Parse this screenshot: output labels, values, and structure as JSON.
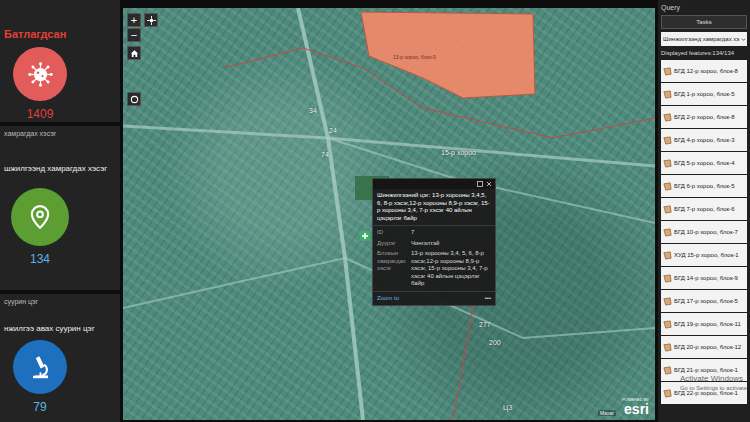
{
  "stats": [
    {
      "title": "Батлагдсан",
      "value": "1409",
      "title_color": "#e0403a",
      "color": "#e25c5c",
      "value_color": "#e0403a",
      "kind": "virus"
    },
    {
      "title": "хамрагдах хэсэг",
      "description": "шжилгээнд хамрагдах хэсэг",
      "value": "134",
      "title_color": "#bbbbbb",
      "color": "#5c9e32",
      "value_color": "#5bb4e6",
      "kind": "pin"
    },
    {
      "title": "суурин цэг",
      "description": "нжилгээ авах суурин цэг",
      "value": "79",
      "title_color": "#bbbbbb",
      "color": "#1f6fbf",
      "value_color": "#5bb4e6",
      "kind": "microscope"
    }
  ],
  "map": {
    "zoom_in": "+",
    "zoom_out": "−",
    "area_label": "13-р хороо, блок-9",
    "labels": [
      "15-р хороо",
      "74",
      "34",
      "277",
      "200",
      "ЦЗ",
      "24"
    ],
    "popup": {
      "title": "Шинжилгээний цэг: 13-р хорооны 3,4,5, 6, 8-р хэсэг,12-р хорооны 8,9-р хэсэг, 15-р хорооны 3,4, 7-р хэсэг 40 айлын цэцэрлэг байр",
      "fields": [
        {
          "label": "ID",
          "value": "7"
        },
        {
          "label": "Дүүрэг",
          "value": "Чингэлтэй"
        },
        {
          "label": "Блокын хамрагдах хэсэг",
          "value": "13-р хорооны 3,4, 5, 6, 8-р хэсэг,12-р хорооны 8,9-р хэсэг, 15-р хорооны 3,4, 7-р хэсэг 40 айлын цэцэрлэг байр"
        }
      ],
      "link": "Zoom to",
      "more": "•••"
    },
    "attribution": "Maxar",
    "logo_prefix": "POWERED BY",
    "logo": "esri"
  },
  "query": {
    "title": "Query",
    "tab": "Tasks",
    "layer": "Шинжилгээнд хамрагдах хэ",
    "count": "Displayed features:134/134",
    "items": [
      "БГД 12-р хороо, блок-8",
      "БГД 1-р хороо, блок-5",
      "БГД 2-р хороо, блок-8",
      "БГД 4-р хороо, блок-3",
      "БГД 5-р хороо, блок-4",
      "БГД 6-р хороо, блок-5",
      "БГД 7-р хороо, блок-6",
      "БГД 10-р хороо, блок-7",
      "ХУД 15-р хороо, блок-1",
      "БГД 14-р хороо, блок-9",
      "БГД 17-р хороо, блок-5",
      "БГД 19-р хороо, блок-11",
      "БГД 20-р хороо, блок-12",
      "БГД 21-р хороо, блок-1",
      "БГД 22-р хороо, блок-1"
    ]
  },
  "watermark": {
    "line1": "Activate Windows",
    "line2": "Go to Settings to activate"
  }
}
